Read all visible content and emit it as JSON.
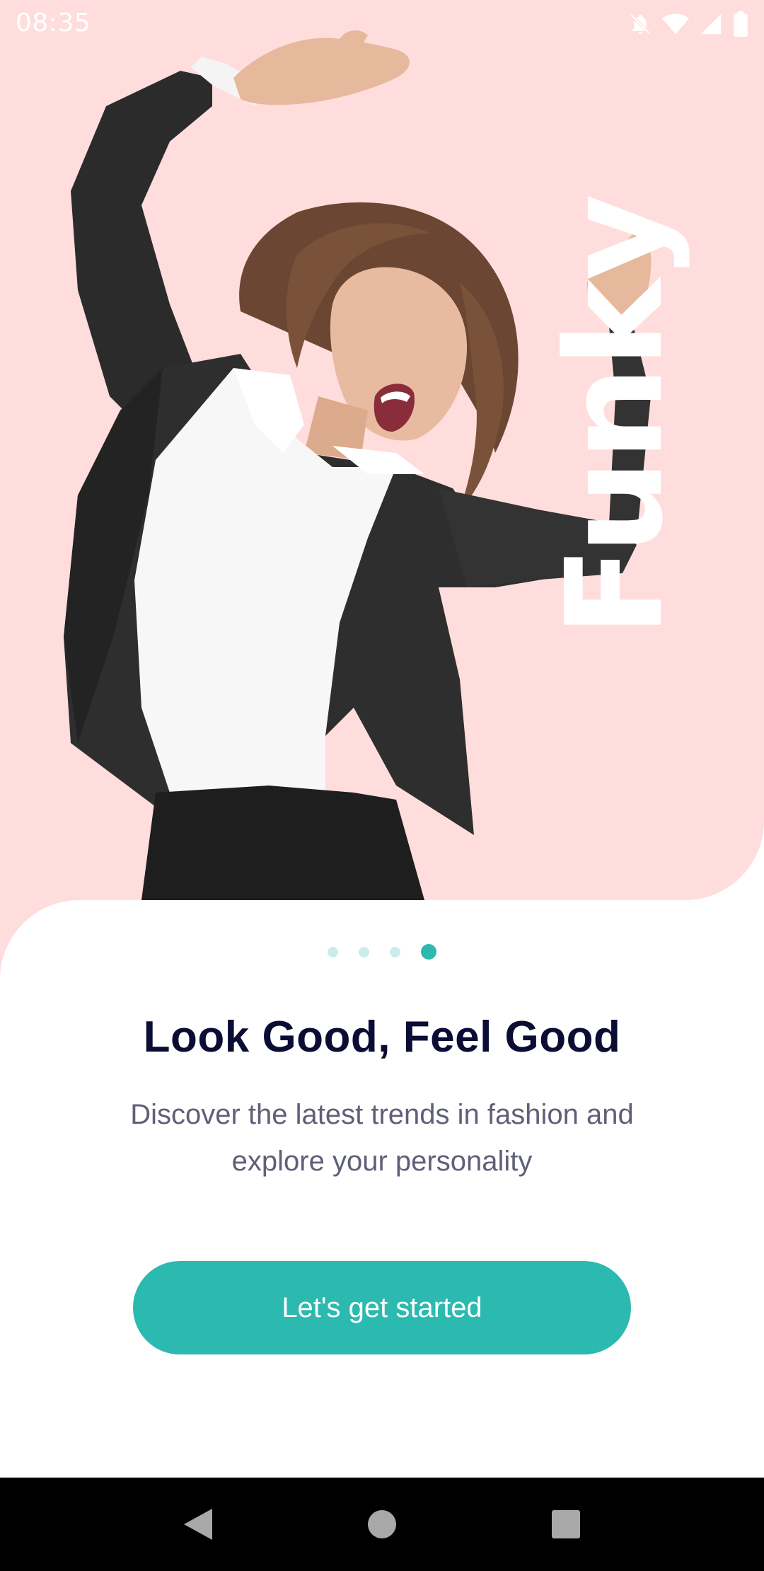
{
  "status_bar": {
    "time": "08:35",
    "icons": [
      "notifications-off-icon",
      "wifi-icon",
      "cellular-signal-icon",
      "battery-icon"
    ]
  },
  "hero": {
    "word": "Funky",
    "background_color": "#FFDDDD",
    "image": "woman-in-black-blazer-dancing-photo"
  },
  "pager": {
    "total": 4,
    "active_index": 3
  },
  "onboarding": {
    "title": "Look Good, Feel Good",
    "subtitle": "Discover the latest trends in fashion and explore your personality",
    "cta_label": "Let's get started"
  },
  "colors": {
    "primary": "#2CB9B0",
    "title": "#0C0D34",
    "body": "#5F6078"
  },
  "nav_bar": {
    "buttons": [
      "back-icon",
      "home-icon",
      "recents-icon"
    ]
  }
}
